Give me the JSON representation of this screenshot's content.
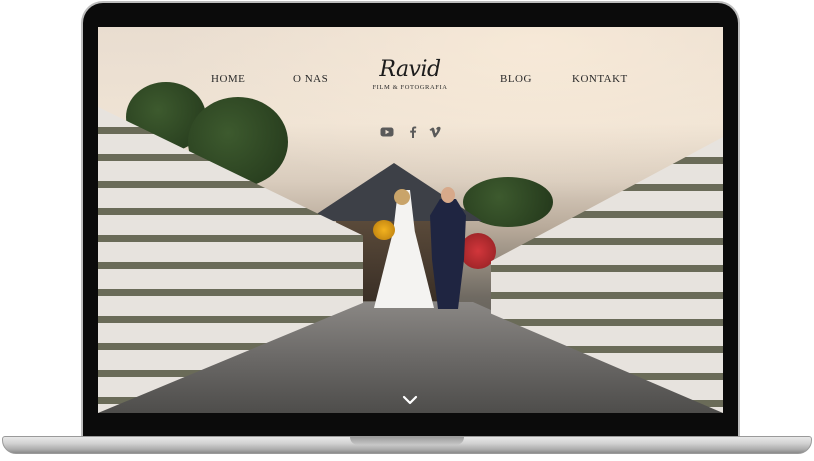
{
  "nav": {
    "home": "HOME",
    "onas": "O NAS",
    "blog": "BLOG",
    "kontakt": "KONTAKT"
  },
  "logo": {
    "script": "Ravid",
    "subtitle": "FILM & FOTOGRAFIA"
  },
  "social": [
    {
      "icon": "youtube-icon"
    },
    {
      "icon": "facebook-icon"
    },
    {
      "icon": "vimeo-icon"
    }
  ],
  "hero": {
    "scroll_icon": "chevron-down-icon"
  },
  "colors": {
    "nav_text": "#2a2a2a",
    "laptop_frame": "#0b0b0b",
    "laptop_base": "#d2d2d2"
  }
}
